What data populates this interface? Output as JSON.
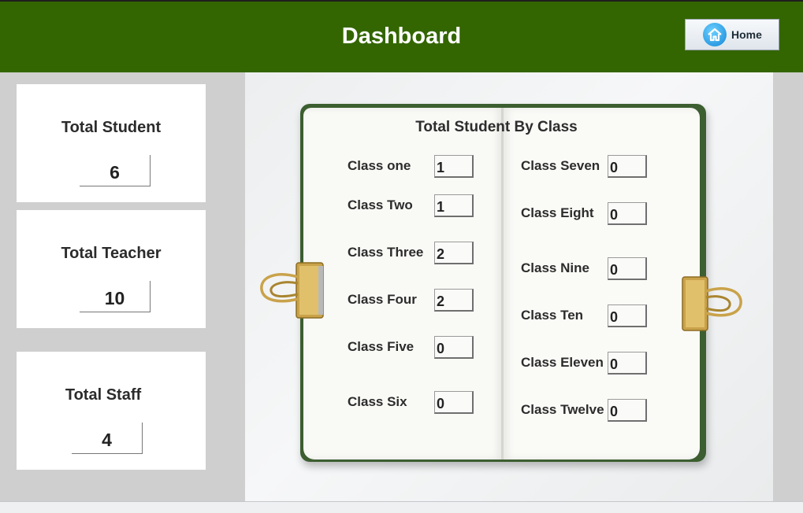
{
  "header": {
    "title": "Dashboard",
    "home_label": "Home",
    "background": "#336600"
  },
  "stats": {
    "total_student": {
      "label": "Total Student",
      "value": "6"
    },
    "total_teacher": {
      "label": "Total Teacher",
      "value": "10"
    },
    "total_staff": {
      "label": "Total Staff",
      "value": "4"
    }
  },
  "by_class": {
    "title": "Total Student By Class",
    "left": [
      {
        "label": "Class one",
        "value": "1"
      },
      {
        "label": "Class Two",
        "value": "1"
      },
      {
        "label": "Class Three",
        "value": "2"
      },
      {
        "label": "Class Four",
        "value": "2"
      },
      {
        "label": "Class Five",
        "value": "0"
      },
      {
        "label": "Class Six",
        "value": "0"
      }
    ],
    "right": [
      {
        "label": "Class Seven",
        "value": "0"
      },
      {
        "label": "Class Eight",
        "value": "0"
      },
      {
        "label": "Class Nine",
        "value": "0"
      },
      {
        "label": "Class Ten",
        "value": "0"
      },
      {
        "label": "Class Eleven",
        "value": "0"
      },
      {
        "label": "Class Twelve",
        "value": "0"
      }
    ]
  },
  "icons": {
    "home": "home-icon",
    "clip": "binder-clip-icon"
  }
}
